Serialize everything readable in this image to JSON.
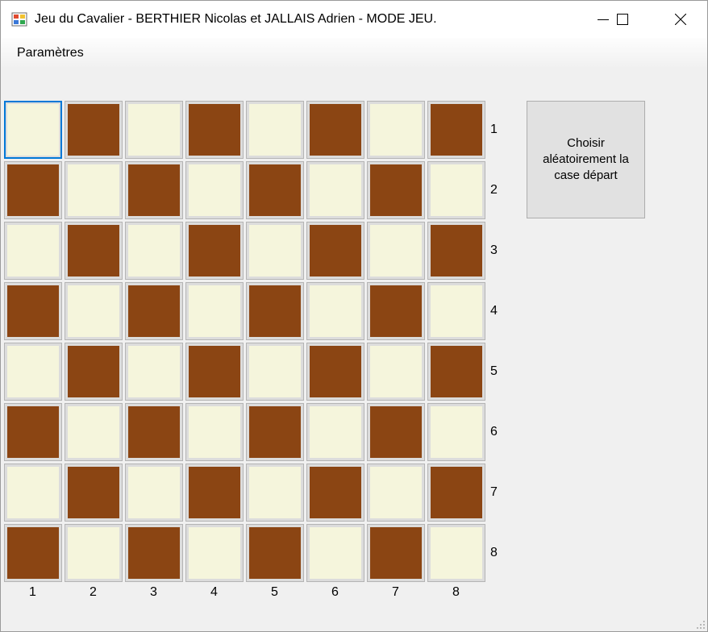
{
  "window": {
    "title": "Jeu du Cavalier - BERTHIER Nicolas et JALLAIS Adrien - MODE JEU.",
    "controls": [
      "minimize-icon",
      "maximize-icon",
      "close-icon"
    ]
  },
  "menu": {
    "items": [
      "Paramètres"
    ]
  },
  "board": {
    "rows": 8,
    "cols": 8,
    "row_labels": [
      "1",
      "2",
      "3",
      "4",
      "5",
      "6",
      "7",
      "8"
    ],
    "col_labels": [
      "1",
      "2",
      "3",
      "4",
      "5",
      "6",
      "7",
      "8"
    ],
    "light_color": "#f5f5dc",
    "dark_color": "#8b4513",
    "selected_cell": {
      "row": 1,
      "col": 1
    }
  },
  "actions": {
    "random_start_label": "Choisir aléatoirement la case départ"
  }
}
